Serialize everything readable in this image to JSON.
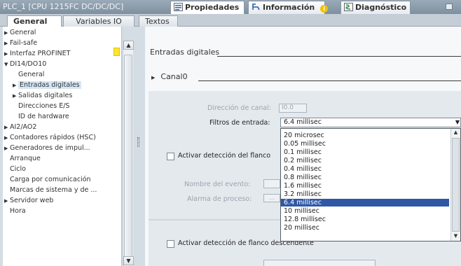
{
  "window": {
    "title": "PLC_1 [CPU 1215FC DC/DC/DC]",
    "inspector_tabs": [
      {
        "label": "Propiedades",
        "active": true
      },
      {
        "label": "Información",
        "active": false
      },
      {
        "label": "Diagnóstico",
        "active": false
      }
    ]
  },
  "tabs": [
    {
      "label": "General",
      "active": true
    },
    {
      "label": "Variables IO",
      "active": false
    },
    {
      "label": "Textos",
      "active": false
    }
  ],
  "tree": {
    "items": [
      {
        "label": "General",
        "arrow": "▶",
        "indent": 0
      },
      {
        "label": "Fail-safe",
        "arrow": "▶",
        "indent": 0
      },
      {
        "label": "Interfaz PROFINET",
        "arrow": "▶",
        "indent": 0
      },
      {
        "label": "DI14/DO10",
        "arrow": "▼",
        "indent": 0
      },
      {
        "label": "General",
        "arrow": "",
        "indent": 1
      },
      {
        "label": "Entradas digitales",
        "arrow": "▶",
        "indent": 1,
        "selected": true
      },
      {
        "label": "Salidas digitales",
        "arrow": "▶",
        "indent": 1
      },
      {
        "label": "Direcciones E/S",
        "arrow": "",
        "indent": 1
      },
      {
        "label": "ID de hardware",
        "arrow": "",
        "indent": 1
      },
      {
        "label": "AI2/AO2",
        "arrow": "▶",
        "indent": 0
      },
      {
        "label": "Contadores rápidos (HSC)",
        "arrow": "▶",
        "indent": 0
      },
      {
        "label": "Generadores de impul...",
        "arrow": "▶",
        "indent": 0
      },
      {
        "label": "Arranque",
        "arrow": "",
        "indent": 0
      },
      {
        "label": "Ciclo",
        "arrow": "",
        "indent": 0
      },
      {
        "label": "Carga por comunicación",
        "arrow": "",
        "indent": 0
      },
      {
        "label": "Marcas de sistema y de ...",
        "arrow": "",
        "indent": 0
      },
      {
        "label": "Servidor web",
        "arrow": "▶",
        "indent": 0
      },
      {
        "label": "Hora",
        "arrow": "",
        "indent": 0
      }
    ]
  },
  "main": {
    "section_title": "Entradas digitales",
    "channel_title": "Canal0",
    "channel_address_label": "Dirección de canal:",
    "channel_address_value": "I0.0",
    "input_filter_label": "Filtros de entrada:",
    "input_filter_value": "6.4 millisec",
    "rising_edge_label": "Activar detección del flanco",
    "event_name_label": "Nombre del evento:",
    "process_alarm_label": "Alarma de proceso:",
    "falling_edge_label": "Activar detección de flanco descendente"
  },
  "filter_options": [
    "20 microsec",
    "0.05 millisec",
    "0.1 millisec",
    "0.2 millisec",
    "0.4 millisec",
    "0.8 millisec",
    "1.6 millisec",
    "3.2 millisec",
    "6.4 millisec",
    "10 millisec",
    "12.8 millisec",
    "20 millisec"
  ],
  "selected_filter_index": 8,
  "colors": {
    "selection": "#2e58a6",
    "warning": "#ffe430",
    "titlebar": "#8a9bab"
  }
}
